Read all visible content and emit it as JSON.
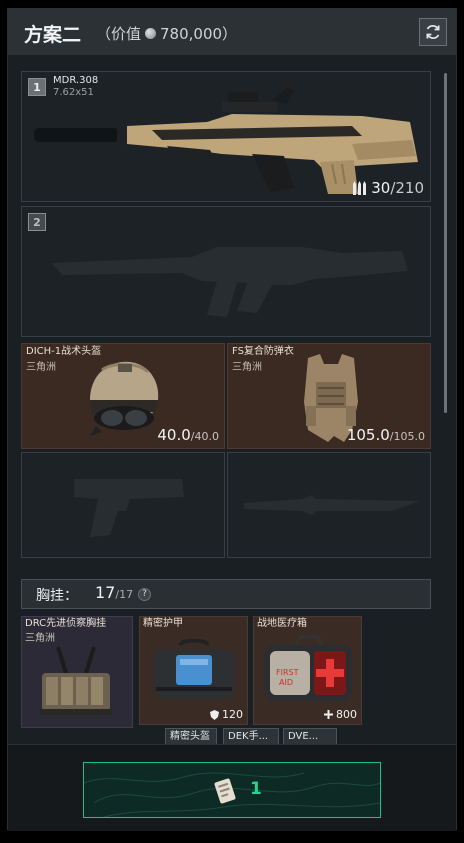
{
  "header": {
    "title": "方案二",
    "value_prefix": "（价值",
    "value_amount": "780,000）"
  },
  "weapons": [
    {
      "slot": "1",
      "name": "MDR.308",
      "caliber": "7.62x51",
      "ammo_current": "30",
      "ammo_max": "/210"
    },
    {
      "slot": "2"
    }
  ],
  "helmet": {
    "name": "DICH-1战术头盔",
    "origin": "三角洲",
    "durability": "40.0",
    "durability_max": "/40.0"
  },
  "armor": {
    "name": "FS复合防弹衣",
    "origin": "三角洲",
    "durability": "105.0",
    "durability_max": "/105.0"
  },
  "rig": {
    "label": "胸挂：",
    "capacity": "17",
    "capacity_max": "/17",
    "help": "?",
    "item_name": "DRC先进侦察胸挂",
    "item_origin": "三角洲"
  },
  "rig_items": [
    {
      "name": "精密护甲",
      "value": "120",
      "value_icon": "shield-icon"
    },
    {
      "name": "战地医疗箱",
      "value": "800",
      "value_icon": "plus-icon"
    }
  ],
  "rig_tags": [
    "精密头盔",
    "DEK手...",
    "DVE..."
  ],
  "footer": {
    "ticket_count": "1"
  },
  "colors": {
    "accent_green": "#24d48f",
    "rarity_brown": "#3a2c24",
    "rarity_purple": "#2b2a36"
  }
}
